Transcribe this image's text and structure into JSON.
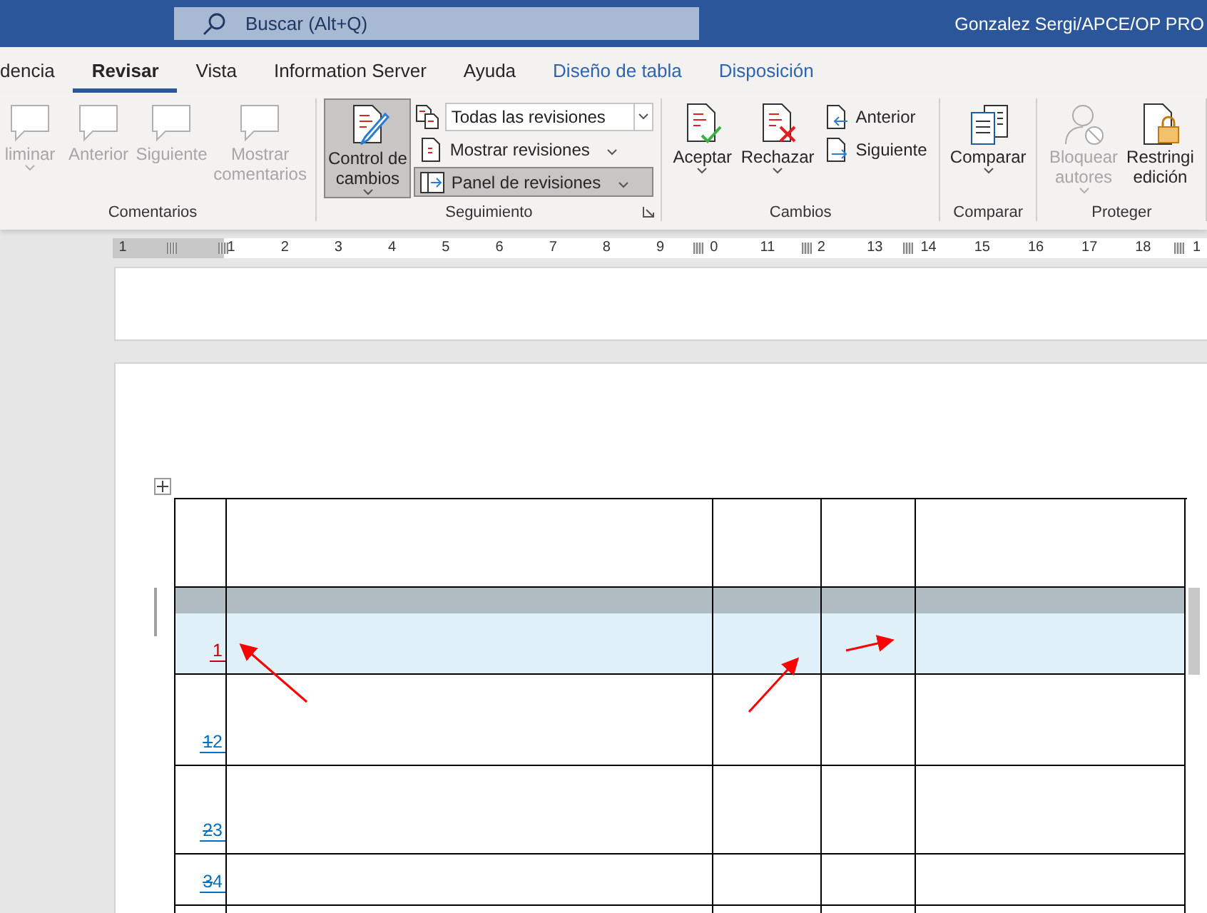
{
  "title_bar": {
    "search_placeholder": "Buscar (Alt+Q)",
    "user": "Gonzalez Sergi/APCE/OP PRO"
  },
  "tabs": [
    {
      "label": "dencia",
      "selected": false,
      "kind": "normal"
    },
    {
      "label": "Revisar",
      "selected": true,
      "kind": "normal"
    },
    {
      "label": "Vista",
      "selected": false,
      "kind": "normal"
    },
    {
      "label": "Information Server",
      "selected": false,
      "kind": "normal"
    },
    {
      "label": "Ayuda",
      "selected": false,
      "kind": "normal"
    },
    {
      "label": "Diseño de tabla",
      "selected": false,
      "kind": "contextual"
    },
    {
      "label": "Disposición",
      "selected": false,
      "kind": "contextual"
    }
  ],
  "ribbon": {
    "groups": [
      {
        "label": "Comentarios",
        "launcher": false,
        "items": [
          {
            "kind": "large",
            "label": "liminar",
            "disabled": true,
            "selected": false,
            "dropdown": true
          },
          {
            "kind": "large",
            "label": "Anterior",
            "disabled": true,
            "selected": false,
            "dropdown": false
          },
          {
            "kind": "large",
            "label": "Siguiente",
            "disabled": true,
            "selected": false,
            "dropdown": false
          },
          {
            "kind": "large",
            "label": "Mostrar\ncomentarios",
            "disabled": true,
            "selected": false,
            "dropdown": false
          }
        ]
      },
      {
        "label": "Seguimiento",
        "launcher": true,
        "items": [
          {
            "kind": "large",
            "label": "Control de\ncambios",
            "disabled": false,
            "selected": true,
            "dropdown": true
          },
          {
            "kind": "stack",
            "items": [
              {
                "kind": "select",
                "value": "Todas las revisiones"
              },
              {
                "kind": "small",
                "label": "Mostrar revisiones",
                "disabled": false,
                "selected": false,
                "dropdown": true
              },
              {
                "kind": "small",
                "label": "Panel de revisiones",
                "disabled": false,
                "selected": true,
                "dropdown": true
              }
            ]
          }
        ]
      },
      {
        "label": "Cambios",
        "launcher": false,
        "items": [
          {
            "kind": "large",
            "label": "Aceptar",
            "disabled": false,
            "selected": false,
            "dropdown": true
          },
          {
            "kind": "large",
            "label": "Rechazar",
            "disabled": false,
            "selected": false,
            "dropdown": true
          },
          {
            "kind": "stack",
            "items": [
              {
                "kind": "small",
                "label": "Anterior",
                "disabled": false,
                "selected": false,
                "dropdown": false
              },
              {
                "kind": "small",
                "label": "Siguiente",
                "disabled": false,
                "selected": false,
                "dropdown": false
              }
            ]
          }
        ]
      },
      {
        "label": "Comparar",
        "launcher": false,
        "items": [
          {
            "kind": "large",
            "label": "Comparar",
            "disabled": false,
            "selected": false,
            "dropdown": true
          }
        ]
      },
      {
        "label": "Proteger",
        "launcher": false,
        "items": [
          {
            "kind": "large",
            "label": "Bloquear\nautores",
            "disabled": true,
            "selected": false,
            "dropdown": true
          },
          {
            "kind": "large",
            "label": "Restringi\nedición",
            "disabled": false,
            "selected": false,
            "dropdown": false
          }
        ]
      }
    ]
  },
  "ruler": {
    "labels": [
      "1",
      "1",
      "2",
      "3",
      "4",
      "5",
      "6",
      "7",
      "8",
      "9",
      "0",
      "11",
      "2",
      "13",
      "14",
      "15",
      "16",
      "17",
      "18",
      "1"
    ]
  },
  "table": {
    "rows": [
      {
        "selected": false
      },
      {
        "selected": true,
        "number": {
          "inserted": "1",
          "color": "#c00000"
        }
      },
      {
        "selected": false,
        "number": {
          "deleted": "1",
          "inserted": "2",
          "color": "#0070c0"
        }
      },
      {
        "selected": false,
        "number": {
          "deleted": "2",
          "inserted": "3",
          "color": "#0070c0"
        }
      },
      {
        "selected": false,
        "number": {
          "deleted": "3",
          "inserted": "4",
          "color": "#0070c0"
        }
      },
      {
        "selected": false
      }
    ]
  }
}
